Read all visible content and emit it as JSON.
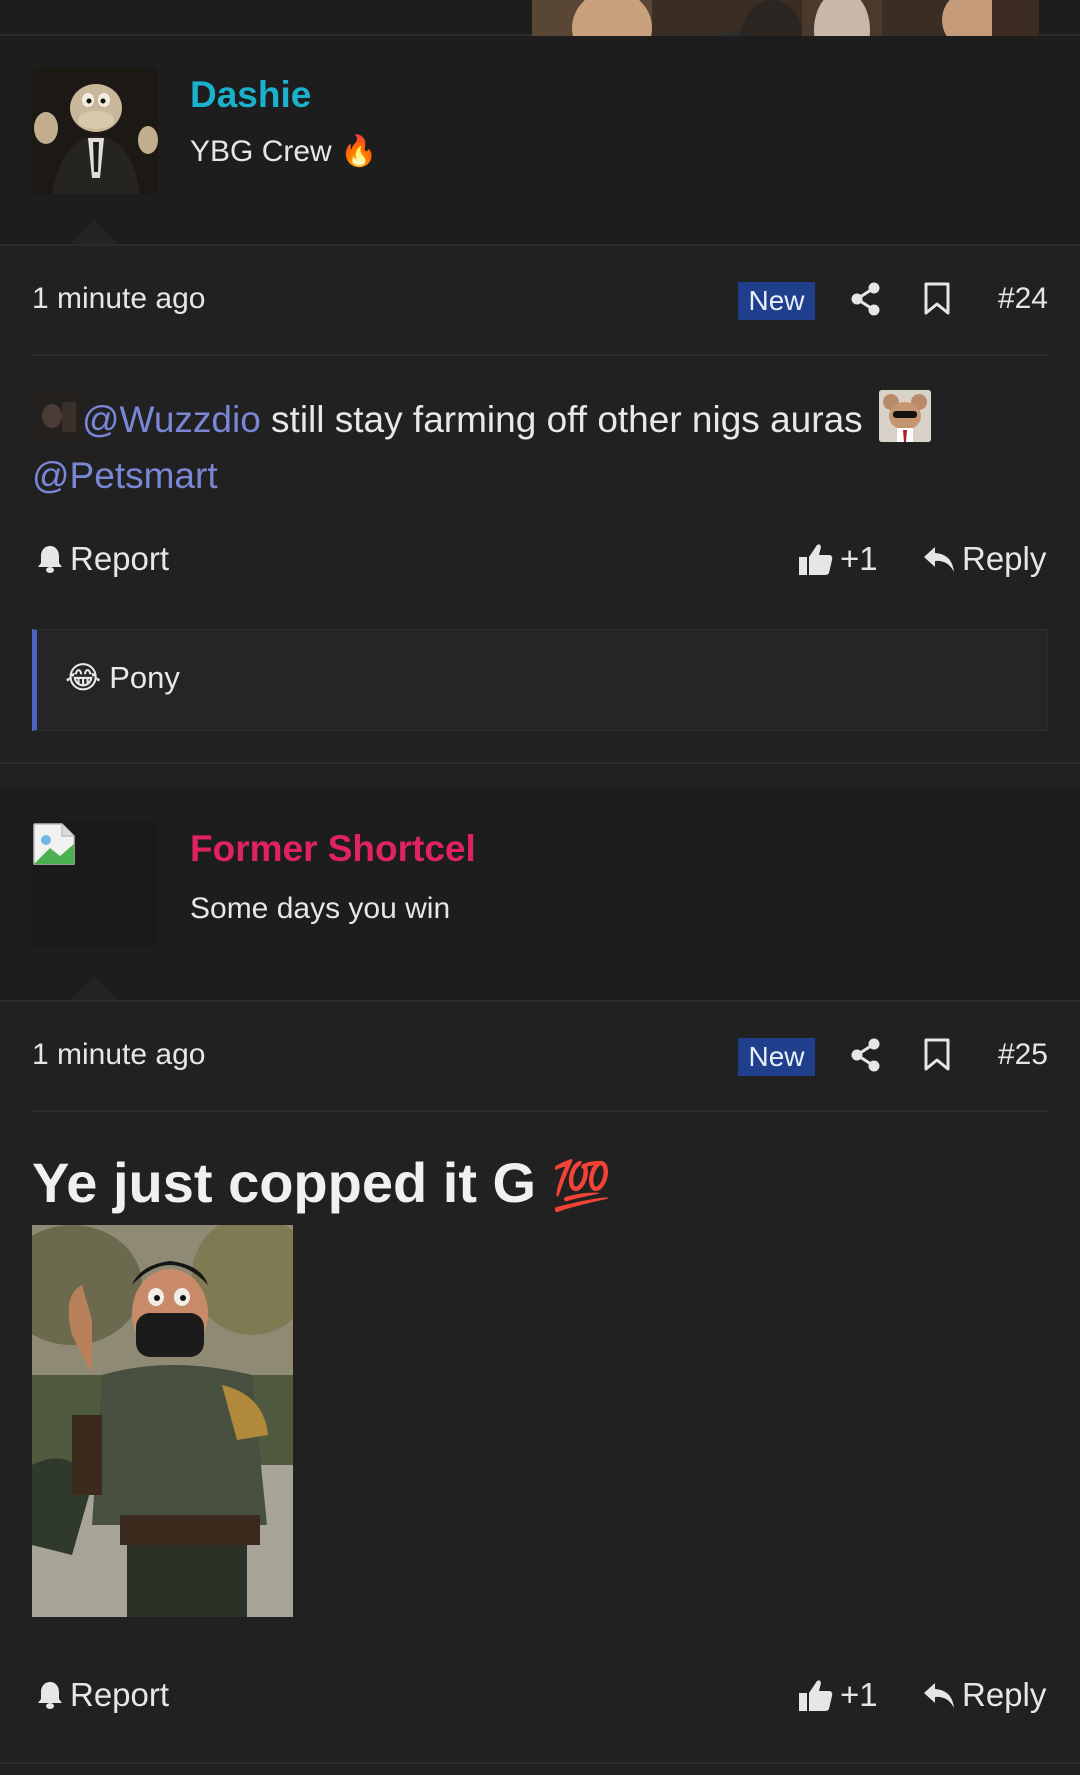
{
  "posts": [
    {
      "author": {
        "name": "Dashie",
        "title": "YBG Crew",
        "title_emoji": "🔥",
        "name_color": "#1bb0cc"
      },
      "time": "1 minute ago",
      "badge": "New",
      "number": "#24",
      "body": {
        "mention1": "@Wuzzdio",
        "text": " still stay farming off other nigs auras ",
        "mention2": "@Petsmart"
      },
      "actions": {
        "report": "Report",
        "like": "+1",
        "reply": "Reply"
      },
      "reactions": {
        "emoji": "😂",
        "label": "Pony"
      }
    },
    {
      "author": {
        "name": "Former Shortcel",
        "title": "Some days you win",
        "name_color": "#e0235f"
      },
      "time": "1 minute ago",
      "badge": "New",
      "number": "#25",
      "body": {
        "heading": "Ye just copped it G",
        "heading_emoji": "💯"
      },
      "actions": {
        "report": "Report",
        "like": "+1",
        "reply": "Reply"
      }
    }
  ],
  "colors": {
    "background": "#212122",
    "band": "#1d1d1e",
    "mention": "#7a86d6",
    "badge": "#1f3f8c"
  }
}
